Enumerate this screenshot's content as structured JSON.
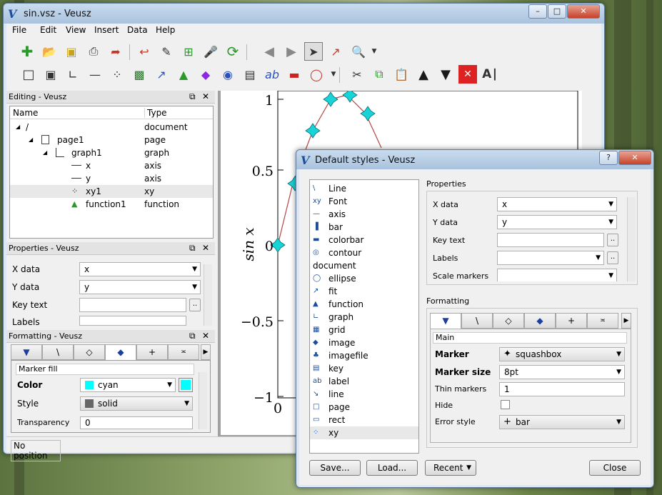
{
  "main_window": {
    "title": "sin.vsz - Veusz",
    "menu": [
      "File",
      "Edit",
      "View",
      "Insert",
      "Data",
      "Help"
    ],
    "status": "No position"
  },
  "editing": {
    "title": "Editing - Veusz",
    "col_name": "Name",
    "col_type": "Type",
    "rows": [
      {
        "name": "/",
        "type": "document"
      },
      {
        "name": "page1",
        "type": "page"
      },
      {
        "name": "graph1",
        "type": "graph"
      },
      {
        "name": "x",
        "type": "axis"
      },
      {
        "name": "y",
        "type": "axis"
      },
      {
        "name": "xy1",
        "type": "xy"
      },
      {
        "name": "function1",
        "type": "function"
      }
    ]
  },
  "properties": {
    "title": "Properties - Veusz",
    "rows": [
      {
        "label": "X data",
        "value": "x"
      },
      {
        "label": "Y data",
        "value": "y"
      },
      {
        "label": "Key text",
        "value": ""
      },
      {
        "label": "Labels",
        "value": ""
      }
    ]
  },
  "formatting": {
    "title": "Formatting - Veusz",
    "section": "Marker fill",
    "color_label": "Color",
    "color_value": "cyan",
    "style_label": "Style",
    "style_value": "solid",
    "transparency_label": "Transparency",
    "transparency_value": "0"
  },
  "plot": {
    "y_ticks": [
      "1",
      "0.5",
      "0",
      "−0.5",
      "−1"
    ],
    "x_tick": "0",
    "ylabel": "sin x"
  },
  "dialog": {
    "title": "Default styles - Veusz",
    "help_btn": "?",
    "close_x": "✕",
    "widgets": [
      "Line",
      "Font",
      "axis",
      "bar",
      "colorbar",
      "contour",
      "document",
      "ellipse",
      "fit",
      "function",
      "graph",
      "grid",
      "image",
      "imagefile",
      "key",
      "label",
      "line",
      "page",
      "rect",
      "xy"
    ],
    "properties_title": "Properties",
    "props": [
      {
        "label": "X data",
        "value": "x"
      },
      {
        "label": "Y data",
        "value": "y"
      },
      {
        "label": "Key text",
        "value": ""
      },
      {
        "label": "Labels",
        "value": ""
      },
      {
        "label": "Scale markers",
        "value": ""
      }
    ],
    "formatting_title": "Formatting",
    "main_label": "Main",
    "marker_label": "Marker",
    "marker_value": "squashbox",
    "marker_size_label": "Marker size",
    "marker_size_value": "8pt",
    "thin_label": "Thin markers",
    "thin_value": "1",
    "hide_label": "Hide",
    "error_label": "Error style",
    "error_value": "bar",
    "buttons": {
      "save": "Save...",
      "load": "Load...",
      "recent": "Recent",
      "close": "Close"
    }
  },
  "colors": {
    "cyan": "#00ffff",
    "accent": "#1b4d9b"
  }
}
